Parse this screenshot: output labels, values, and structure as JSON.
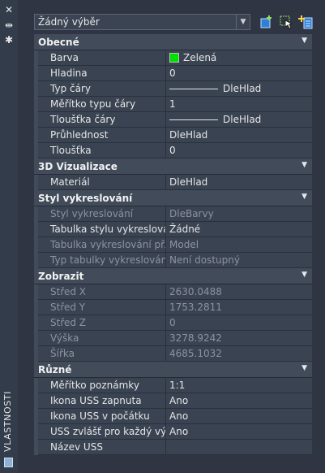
{
  "palette": {
    "title": "VLASTNOSTI",
    "selector": "Žádný výběr"
  },
  "toolbar": {
    "buttons": [
      "quick-select-icon",
      "select-objects-icon",
      "toggle-pickadd-icon"
    ]
  },
  "sections": [
    {
      "title": "Obecné",
      "rows": [
        {
          "label": "Barva",
          "value": "Zelená",
          "kind": "color",
          "color": "#00e000"
        },
        {
          "label": "Hladina",
          "value": "0"
        },
        {
          "label": "Typ čáry",
          "value": "DleHlad",
          "kind": "line"
        },
        {
          "label": "Měřítko typu čáry",
          "value": "1"
        },
        {
          "label": "Tloušťka čáry",
          "value": "DleHlad",
          "kind": "line"
        },
        {
          "label": "Průhlednost",
          "value": "DleHlad"
        },
        {
          "label": "Tloušťka",
          "value": "0"
        }
      ]
    },
    {
      "title": "3D Vizualizace",
      "rows": [
        {
          "label": "Materiál",
          "value": "DleHlad"
        }
      ]
    },
    {
      "title": "Styl vykreslování",
      "rows": [
        {
          "label": "Styl vykreslování",
          "value": "DleBarvy",
          "dim": true
        },
        {
          "label": "Tabulka stylu vykreslování",
          "value": "Žádné"
        },
        {
          "label": "Tabulka vykreslování př...",
          "value": "Model",
          "dim": true
        },
        {
          "label": "Typ tabulky vykreslování",
          "value": "Není dostupný",
          "dim": true
        }
      ]
    },
    {
      "title": "Zobrazit",
      "rows": [
        {
          "label": "Střed X",
          "value": "2630.0488",
          "dim": true
        },
        {
          "label": "Střed Y",
          "value": "1753.2811",
          "dim": true
        },
        {
          "label": "Střed Z",
          "value": "0",
          "dim": true
        },
        {
          "label": "Výška",
          "value": "3278.9242",
          "dim": true
        },
        {
          "label": "Šířka",
          "value": "4685.1032",
          "dim": true
        }
      ]
    },
    {
      "title": "Různé",
      "rows": [
        {
          "label": "Měřítko poznámky",
          "value": "1:1"
        },
        {
          "label": "Ikona USS zapnuta",
          "value": "Ano"
        },
        {
          "label": "Ikona USS v počátku",
          "value": "Ano"
        },
        {
          "label": "USS zvlášť pro každý vý...",
          "value": "Ano"
        },
        {
          "label": "Název USS",
          "value": ""
        }
      ]
    }
  ]
}
